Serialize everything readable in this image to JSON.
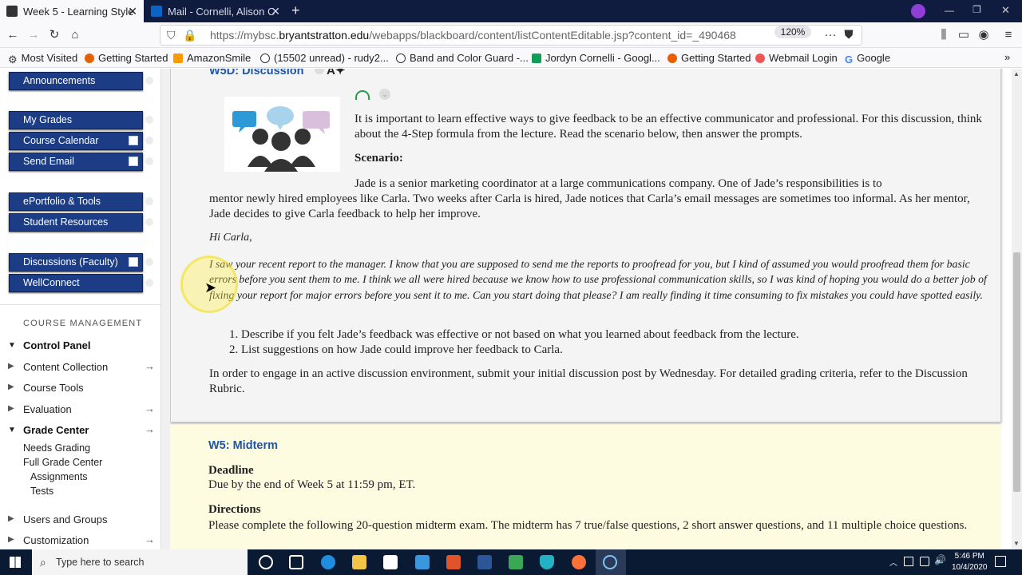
{
  "browser": {
    "tabs": [
      {
        "title": "Week 5 - Learning Style",
        "close": "✕"
      },
      {
        "title": "Mail - Cornelli, Alison C",
        "close": "✕"
      }
    ],
    "new_tab": "+",
    "url_prefix": "https://mybsc.",
    "url_domain": "bryantstratton.edu",
    "url_path": "/webapps/blackboard/content/listContentEditable.jsp?content_id=_490468",
    "zoom": "120%",
    "bookmarks": [
      "Most Visited",
      "Getting Started",
      "AmazonSmile",
      "(15502 unread) - rudy2...",
      "Band and Color Guard -...",
      "Jordyn Cornelli - Googl...",
      "Getting Started",
      "Webmail Login",
      "Google"
    ]
  },
  "sidebar": {
    "buttons": [
      "Announcements",
      "My Grades",
      "Course Calendar",
      "Send Email",
      "ePortfolio & Tools",
      "Student Resources",
      "Discussions (Faculty)",
      "WellConnect"
    ],
    "course_management_title": "COURSE MANAGEMENT",
    "control_panel": "Control Panel",
    "items": [
      "Content Collection",
      "Course Tools",
      "Evaluation",
      "Grade Center",
      "Needs Grading",
      "Full Grade Center",
      "Assignments",
      "Tests",
      "Users and Groups",
      "Customization"
    ]
  },
  "discussion": {
    "title": "W5D: Discussion",
    "intro": "It is important to learn effective ways to give feedback to be an effective communicator and professional. For this discussion, think about the 4-Step formula from the lecture. Read the scenario below, then answer the prompts.",
    "scenario_heading": "Scenario:",
    "scenario_line1": "Jade is a senior marketing coordinator at a large communications company. One of Jade’s responsibilities is to",
    "scenario_rest": "mentor newly hired employees like Carla. Two weeks after Carla is hired, Jade notices that Carla’s email messages are sometimes too informal. As her mentor, Jade decides to give Carla feedback to help her improve.",
    "greeting": "Hi Carla,",
    "email": "I saw your recent report to the manager. I know that you are supposed to send me the reports to proofread for you, but I kind of assumed you would proofread them for basic errors before you sent them to me. I think we all were hired because we know how to use professional communication skills, so I was kind of hoping you would do a better job of fixing your report for major errors before you sent it to me. Can you start doing that please? I am really finding it time consuming to fix mistakes you could have spotted easily.",
    "prompts": [
      "Describe if you felt Jade’s feedback was effective or not based on what you learned about feedback from the lecture.",
      "List suggestions on how Jade could improve her feedback to Carla."
    ],
    "closing": "In order to engage in an active discussion environment, submit your initial discussion post by Wednesday. For detailed grading criteria, refer to the Discussion Rubric."
  },
  "midterm": {
    "title": "W5: Midterm",
    "deadline_heading": "Deadline",
    "deadline": "Due by the end of Week 5 at 11:59 pm, ET.",
    "directions_heading": "Directions",
    "directions": "Please complete the following 20-question midterm exam. The midterm has 7 true/false questions, 2 short answer questions, and 11 multiple choice questions."
  },
  "taskbar": {
    "search_placeholder": "Type here to search",
    "time": "5:46 PM",
    "date": "10/4/2020"
  },
  "colors": {
    "sidebar_button": "#1c3d86",
    "link": "#1f56a6",
    "midterm_bg": "#fdfbe0"
  }
}
